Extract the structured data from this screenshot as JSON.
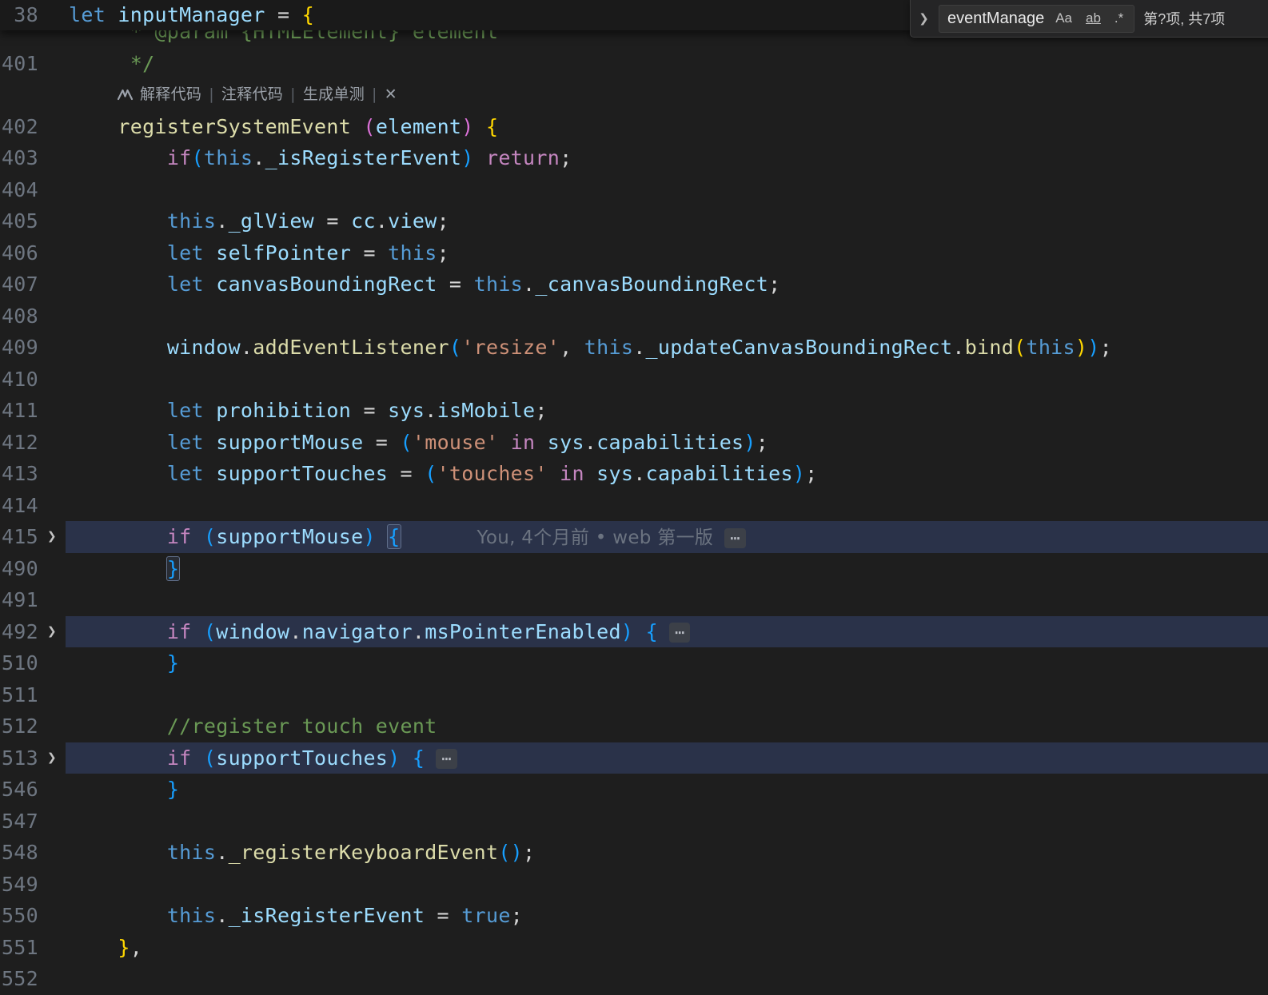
{
  "colors": {
    "kw": "#569CD6",
    "ctrl": "#C586C0",
    "var": "#9CDCFE",
    "fn": "#DCDCAA",
    "str": "#CE9178",
    "cmt": "#6A9955",
    "pun": "#D4D4D4",
    "b1": "#FFD700",
    "b2": "#DA70D6",
    "b3": "#179FFF",
    "": "#D4D4D4",
    "highlight_row": "#2a3249",
    "editor_bg": "#1e1e1e",
    "line_number": "#6e7681"
  },
  "icons": {
    "toggle": "❯",
    "fold": "❯",
    "badge": "⋯"
  },
  "find": {
    "query": "eventManage",
    "match_case": "Aa",
    "whole_word": "ab",
    "regex": ".*",
    "results": "第?项, 共7项"
  },
  "editor": {
    "sticky": {
      "n": "38",
      "seg": [
        [
          "let",
          "kw"
        ],
        [
          " ",
          ""
        ],
        [
          "inputManager",
          "var"
        ],
        [
          " = ",
          "pun"
        ],
        [
          "{",
          "b1"
        ]
      ]
    },
    "codelens": {
      "items": [
        "解释代码",
        "注释代码",
        "生成单测",
        "✕"
      ]
    },
    "rows": [
      {
        "n": "",
        "seg": [
          [
            "     * @param {HTMLElement} element",
            "cmt"
          ]
        ]
      },
      {
        "n": "401",
        "seg": [
          [
            "     */",
            "cmt"
          ]
        ]
      },
      {
        "type": "codelens"
      },
      {
        "n": "402",
        "seg": [
          [
            "    ",
            ""
          ],
          [
            "registerSystemEvent",
            "fn"
          ],
          [
            " ",
            ""
          ],
          [
            "(",
            "b2"
          ],
          [
            "element",
            "var"
          ],
          [
            ")",
            "b2"
          ],
          [
            " ",
            ""
          ],
          [
            "{",
            "b1"
          ]
        ]
      },
      {
        "n": "403",
        "seg": [
          [
            "        ",
            ""
          ],
          [
            "if",
            "ctrl"
          ],
          [
            "(",
            "b3"
          ],
          [
            "this",
            "kw"
          ],
          [
            ".",
            "pun"
          ],
          [
            "_isRegisterEvent",
            "var"
          ],
          [
            ")",
            "b3"
          ],
          [
            " ",
            ""
          ],
          [
            "return",
            "ctrl"
          ],
          [
            ";",
            "pun"
          ]
        ]
      },
      {
        "n": "404",
        "seg": []
      },
      {
        "n": "405",
        "seg": [
          [
            "        ",
            ""
          ],
          [
            "this",
            "kw"
          ],
          [
            ".",
            "pun"
          ],
          [
            "_glView",
            "var"
          ],
          [
            " = ",
            "pun"
          ],
          [
            "cc",
            "var"
          ],
          [
            ".",
            "pun"
          ],
          [
            "view",
            "var"
          ],
          [
            ";",
            "pun"
          ]
        ]
      },
      {
        "n": "406",
        "seg": [
          [
            "        ",
            ""
          ],
          [
            "let",
            "kw"
          ],
          [
            " ",
            ""
          ],
          [
            "selfPointer",
            "var"
          ],
          [
            " = ",
            "pun"
          ],
          [
            "this",
            "kw"
          ],
          [
            ";",
            "pun"
          ]
        ]
      },
      {
        "n": "407",
        "seg": [
          [
            "        ",
            ""
          ],
          [
            "let",
            "kw"
          ],
          [
            " ",
            ""
          ],
          [
            "canvasBoundingRect",
            "var"
          ],
          [
            " = ",
            "pun"
          ],
          [
            "this",
            "kw"
          ],
          [
            ".",
            "pun"
          ],
          [
            "_canvasBoundingRect",
            "var"
          ],
          [
            ";",
            "pun"
          ]
        ]
      },
      {
        "n": "408",
        "seg": []
      },
      {
        "n": "409",
        "seg": [
          [
            "        ",
            ""
          ],
          [
            "window",
            "var"
          ],
          [
            ".",
            "pun"
          ],
          [
            "addEventListener",
            "fn"
          ],
          [
            "(",
            "b3"
          ],
          [
            "'resize'",
            "str"
          ],
          [
            ", ",
            "pun"
          ],
          [
            "this",
            "kw"
          ],
          [
            ".",
            "pun"
          ],
          [
            "_updateCanvasBoundingRect",
            "var"
          ],
          [
            ".",
            "pun"
          ],
          [
            "bind",
            "fn"
          ],
          [
            "(",
            "b1"
          ],
          [
            "this",
            "kw"
          ],
          [
            ")",
            "b1"
          ],
          [
            ")",
            "b3"
          ],
          [
            ";",
            "pun"
          ]
        ]
      },
      {
        "n": "410",
        "seg": []
      },
      {
        "n": "411",
        "seg": [
          [
            "        ",
            ""
          ],
          [
            "let",
            "kw"
          ],
          [
            " ",
            ""
          ],
          [
            "prohibition",
            "var"
          ],
          [
            " = ",
            "pun"
          ],
          [
            "sys",
            "var"
          ],
          [
            ".",
            "pun"
          ],
          [
            "isMobile",
            "var"
          ],
          [
            ";",
            "pun"
          ]
        ]
      },
      {
        "n": "412",
        "seg": [
          [
            "        ",
            ""
          ],
          [
            "let",
            "kw"
          ],
          [
            " ",
            ""
          ],
          [
            "supportMouse",
            "var"
          ],
          [
            " = ",
            "pun"
          ],
          [
            "(",
            "b3"
          ],
          [
            "'mouse'",
            "str"
          ],
          [
            " ",
            ""
          ],
          [
            "in",
            "ctrl"
          ],
          [
            " ",
            ""
          ],
          [
            "sys",
            "var"
          ],
          [
            ".",
            "pun"
          ],
          [
            "capabilities",
            "var"
          ],
          [
            ")",
            "b3"
          ],
          [
            ";",
            "pun"
          ]
        ]
      },
      {
        "n": "413",
        "seg": [
          [
            "        ",
            ""
          ],
          [
            "let",
            "kw"
          ],
          [
            " ",
            ""
          ],
          [
            "supportTouches",
            "var"
          ],
          [
            " = ",
            "pun"
          ],
          [
            "(",
            "b3"
          ],
          [
            "'touches'",
            "str"
          ],
          [
            " ",
            ""
          ],
          [
            "in",
            "ctrl"
          ],
          [
            " ",
            ""
          ],
          [
            "sys",
            "var"
          ],
          [
            ".",
            "pun"
          ],
          [
            "capabilities",
            "var"
          ],
          [
            ")",
            "b3"
          ],
          [
            ";",
            "pun"
          ]
        ]
      },
      {
        "n": "414",
        "seg": []
      },
      {
        "n": "415",
        "hl": true,
        "fold": true,
        "blame": "You, 4个月前 • web 第一版",
        "badge": true,
        "seg": [
          [
            "        ",
            ""
          ],
          [
            "if",
            "ctrl"
          ],
          [
            " ",
            ""
          ],
          [
            "(",
            "b3"
          ],
          [
            "supportMouse",
            "var"
          ],
          [
            ")",
            "b3"
          ],
          [
            " ",
            ""
          ],
          [
            "{",
            "b3",
            "box"
          ]
        ]
      },
      {
        "n": "490",
        "seg": [
          [
            "        ",
            ""
          ],
          [
            "}",
            "b3",
            "box"
          ]
        ]
      },
      {
        "n": "491",
        "seg": []
      },
      {
        "n": "492",
        "hl": true,
        "fold": true,
        "badge": true,
        "seg": [
          [
            "        ",
            ""
          ],
          [
            "if",
            "ctrl"
          ],
          [
            " ",
            ""
          ],
          [
            "(",
            "b3"
          ],
          [
            "window",
            "var"
          ],
          [
            ".",
            "pun"
          ],
          [
            "navigator",
            "var"
          ],
          [
            ".",
            "pun"
          ],
          [
            "msPointerEnabled",
            "var"
          ],
          [
            ")",
            "b3"
          ],
          [
            " ",
            ""
          ],
          [
            "{",
            "b3"
          ]
        ]
      },
      {
        "n": "510",
        "seg": [
          [
            "        ",
            ""
          ],
          [
            "}",
            "b3"
          ]
        ]
      },
      {
        "n": "511",
        "seg": []
      },
      {
        "n": "512",
        "seg": [
          [
            "        //register touch event",
            "cmt"
          ]
        ]
      },
      {
        "n": "513",
        "hl": true,
        "fold": true,
        "badge": true,
        "seg": [
          [
            "        ",
            ""
          ],
          [
            "if",
            "ctrl"
          ],
          [
            " ",
            ""
          ],
          [
            "(",
            "b3"
          ],
          [
            "supportTouches",
            "var"
          ],
          [
            ")",
            "b3"
          ],
          [
            " ",
            ""
          ],
          [
            "{",
            "b3"
          ]
        ]
      },
      {
        "n": "546",
        "seg": [
          [
            "        ",
            ""
          ],
          [
            "}",
            "b3"
          ]
        ]
      },
      {
        "n": "547",
        "seg": []
      },
      {
        "n": "548",
        "seg": [
          [
            "        ",
            ""
          ],
          [
            "this",
            "kw"
          ],
          [
            ".",
            "pun"
          ],
          [
            "_registerKeyboardEvent",
            "fn"
          ],
          [
            "(",
            "b3"
          ],
          [
            ")",
            "b3"
          ],
          [
            ";",
            "pun"
          ]
        ]
      },
      {
        "n": "549",
        "seg": []
      },
      {
        "n": "550",
        "seg": [
          [
            "        ",
            ""
          ],
          [
            "this",
            "kw"
          ],
          [
            ".",
            "pun"
          ],
          [
            "_isRegisterEvent",
            "var"
          ],
          [
            " = ",
            "pun"
          ],
          [
            "true",
            "kw"
          ],
          [
            ";",
            "pun"
          ]
        ]
      },
      {
        "n": "551",
        "seg": [
          [
            "    ",
            ""
          ],
          [
            "}",
            "b1"
          ],
          [
            ",",
            "pun"
          ]
        ]
      },
      {
        "n": "552",
        "seg": []
      }
    ]
  }
}
